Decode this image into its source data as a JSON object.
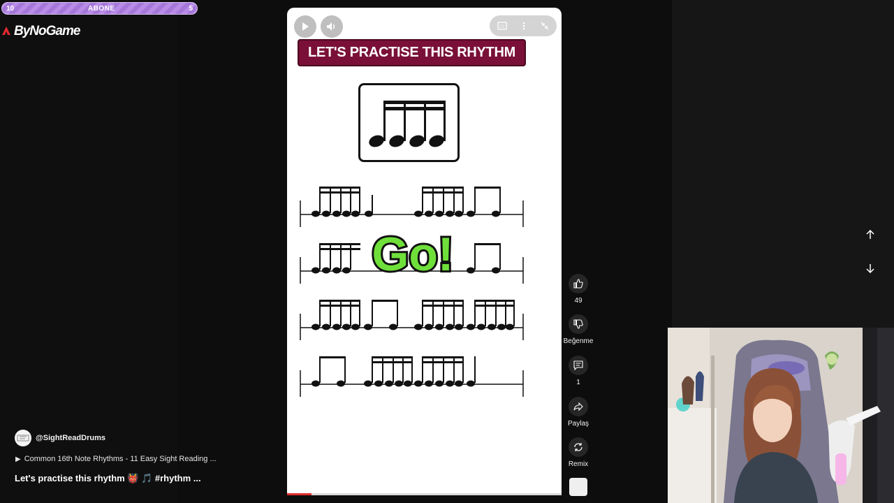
{
  "subscribe_bar": {
    "left_value": "10",
    "label": "ABONE",
    "right_value": "5"
  },
  "logo": {
    "text": "ByNoGame"
  },
  "channel": {
    "handle": "@SightReadDrums",
    "avatar_text": "SIGHT READ DRUMS"
  },
  "playlist": {
    "title": "Common 16th Note Rhythms - 11 Easy Sight Reading ..."
  },
  "video": {
    "title": "Let's practise this rhythm 👹 🎵 #rhythm ..."
  },
  "short": {
    "banner": "LET'S PRACTISE THIS RHYTHM",
    "overlay_text": "Go!",
    "progress": 0.09
  },
  "actions": {
    "like_count": "49",
    "dislike_label": "Beğenme",
    "comments_count": "1",
    "share_label": "Paylaş",
    "remix_label": "Remix"
  },
  "colors": {
    "banner_bg": "#7a1037",
    "go_green": "#6fe03a",
    "subscribe_bar": "#b98ce8"
  },
  "icons": [
    "play-icon",
    "volume-icon",
    "captions-icon",
    "more-icon",
    "collapse-icon",
    "like-icon",
    "dislike-icon",
    "comment-icon",
    "share-icon",
    "remix-icon",
    "arrow-up-icon",
    "arrow-down-icon"
  ]
}
